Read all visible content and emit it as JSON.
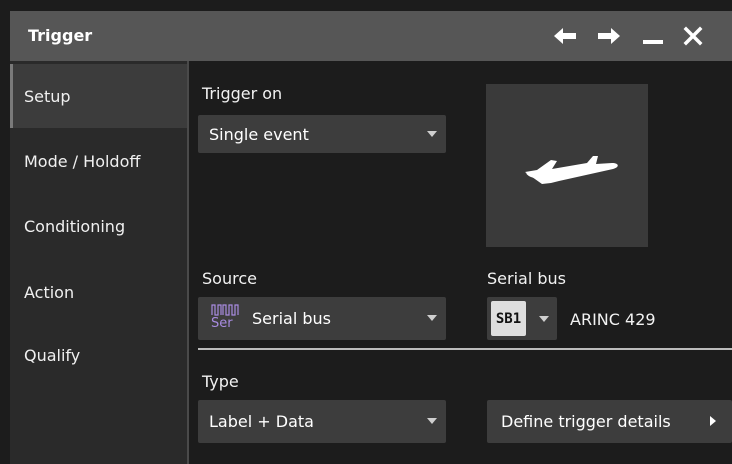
{
  "window": {
    "title": "Trigger"
  },
  "titlebar_icons": [
    "arrow-left-icon",
    "arrow-right-icon",
    "minimize-icon",
    "close-icon"
  ],
  "sidebar": {
    "items": [
      {
        "label": "Setup",
        "active": true
      },
      {
        "label": "Mode / Holdoff",
        "active": false
      },
      {
        "label": "Conditioning",
        "active": false
      },
      {
        "label": "Action",
        "active": false
      },
      {
        "label": "Qualify",
        "active": false
      }
    ]
  },
  "trigger_on": {
    "label": "Trigger on",
    "value": "Single event"
  },
  "preview_icon": "airplane-icon",
  "source": {
    "label": "Source",
    "value": "Serial bus",
    "icon_text": "Ser"
  },
  "serial_bus": {
    "label": "Serial bus",
    "selector": "SB1",
    "protocol": "ARINC 429"
  },
  "type": {
    "label": "Type",
    "value": "Label + Data"
  },
  "define_button": {
    "label": "Define trigger details"
  },
  "colors": {
    "titlebar": "#565656",
    "sidebar": "#2a2a2a",
    "sidebar_active": "#3c3c3c",
    "content": "#1c1c1c",
    "control": "#3d3d3d",
    "ser_icon": "#a88be0"
  }
}
